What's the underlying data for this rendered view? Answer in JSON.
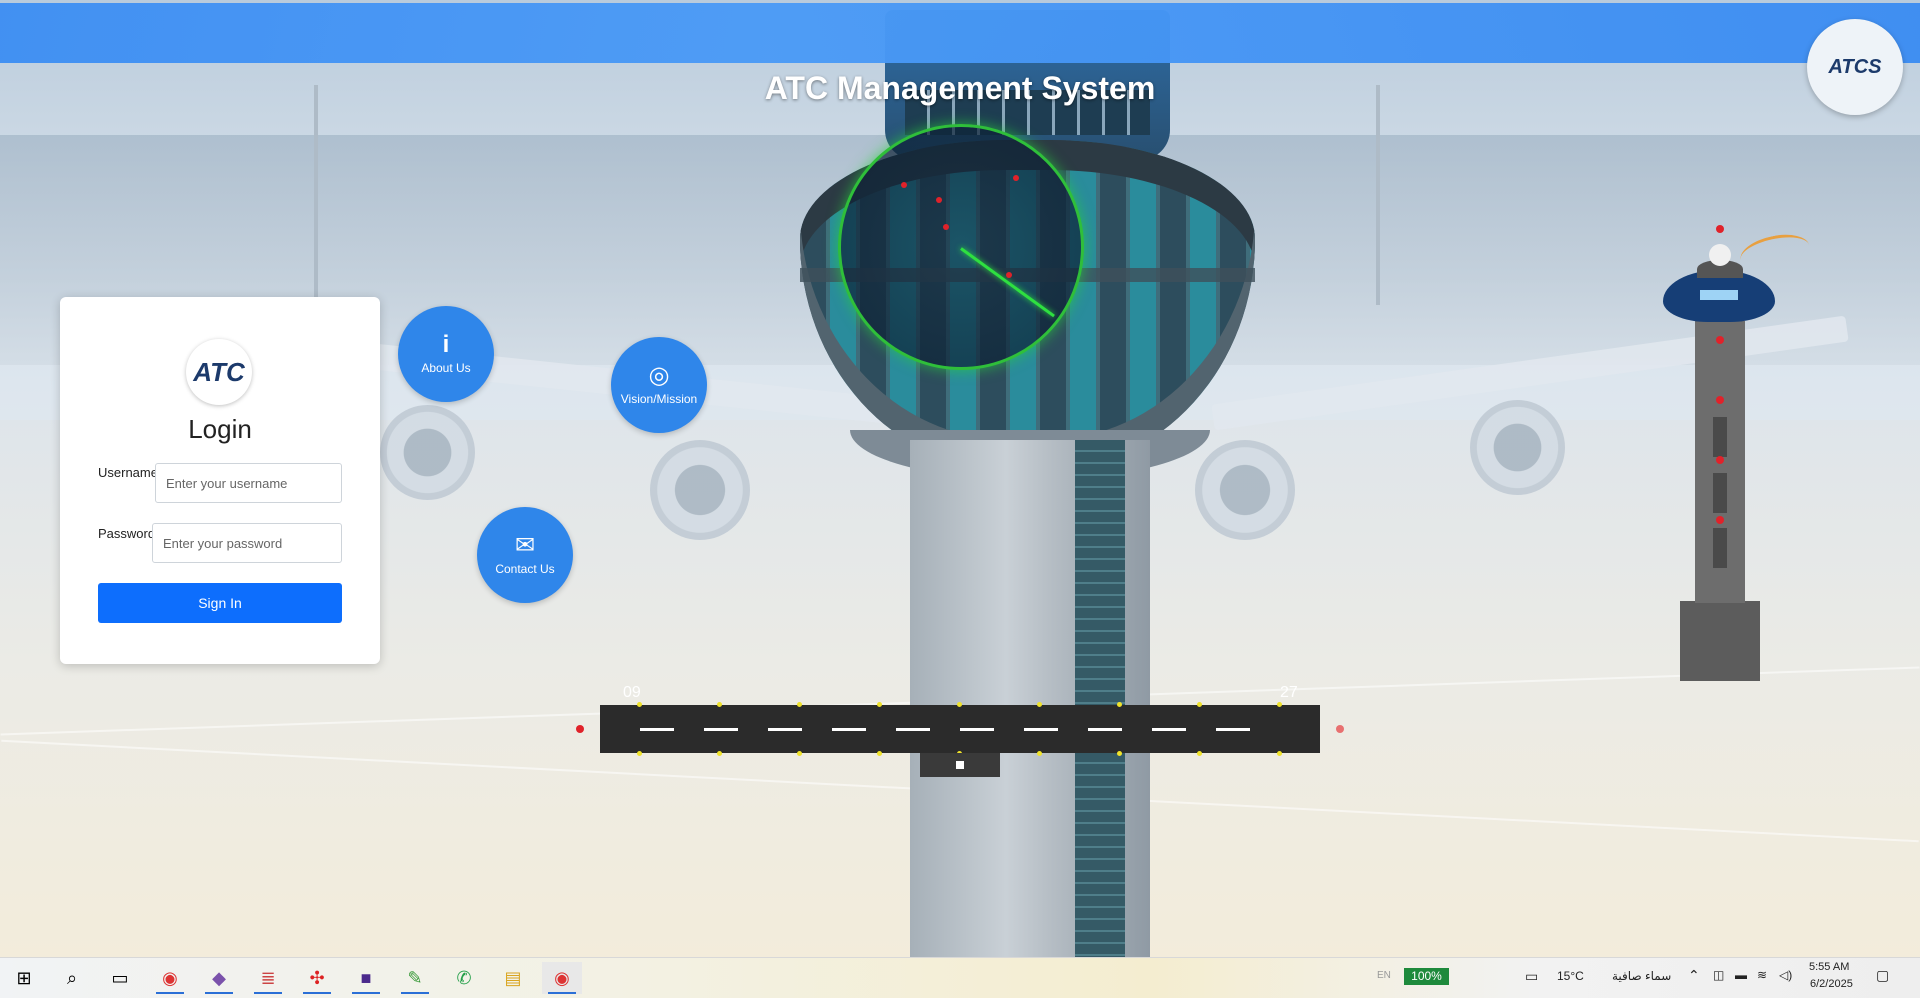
{
  "header": {
    "title": "ATC Management System",
    "corner_logo_text": "ATCS"
  },
  "login": {
    "logo_text": "ATC",
    "title": "Login",
    "username_label": "Username",
    "username_placeholder": "Enter your username",
    "password_label": "Password",
    "password_placeholder": "Enter your password",
    "submit_label": "Sign In"
  },
  "nav_buttons": [
    {
      "label": "About Us",
      "icon": "info-icon"
    },
    {
      "label": "Vision/Mission",
      "icon": "target-icon"
    },
    {
      "label": "Contact Us",
      "icon": "envelope-icon"
    }
  ],
  "runway": {
    "left_number": "09",
    "right_number": "27"
  },
  "taskbar": {
    "apps": [
      {
        "name": "start-icon"
      },
      {
        "name": "search-icon"
      },
      {
        "name": "task-view-icon"
      },
      {
        "name": "chrome-icon"
      },
      {
        "name": "visual-studio-icon"
      },
      {
        "name": "database-tool-icon"
      },
      {
        "name": "network-tool-icon"
      },
      {
        "name": "media-app-icon"
      },
      {
        "name": "notepad-icon"
      },
      {
        "name": "whatsapp-icon"
      },
      {
        "name": "file-explorer-icon"
      },
      {
        "name": "chrome-active-icon"
      }
    ],
    "language": "EN",
    "battery": "100%",
    "temperature": "15°C",
    "weather": "سماء صافية",
    "time": "5:55 AM",
    "date": "6/2/2025"
  },
  "colors": {
    "header_blue": "#3d8ef3",
    "button_blue": "#0d6efd",
    "circle_blue": "#2f86ea",
    "radar_green": "#2fbf3a",
    "runway": "#2b2b2b"
  }
}
